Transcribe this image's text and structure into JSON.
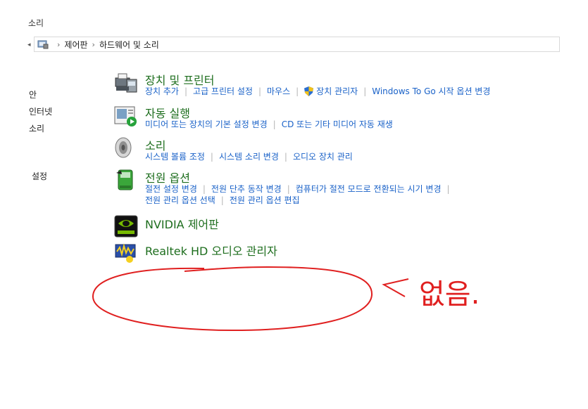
{
  "window": {
    "title": "소리"
  },
  "address": {
    "crumbs": [
      "제어판",
      "하드웨어 및 소리"
    ]
  },
  "left_nav": [
    "안",
    "인터넷",
    "소리",
    "설정"
  ],
  "categories": [
    {
      "title": "장치 및 프린터",
      "icon": "printer-icon",
      "rows": [
        [
          "장치 추가",
          "고급 프린터 설정",
          "마우스",
          "장치 관리자",
          "Windows To Go 시작 옵션 변경"
        ]
      ]
    },
    {
      "title": "자동 실행",
      "icon": "autoplay-icon",
      "rows": [
        [
          "미디어 또는 장치의 기본 설정 변경",
          "CD 또는 기타 미디어 자동 재생"
        ]
      ]
    },
    {
      "title": "소리",
      "icon": "speaker-icon",
      "rows": [
        [
          "시스템 볼륨 조정",
          "시스템 소리 변경",
          "오디오 장치 관리"
        ]
      ]
    },
    {
      "title": "전원 옵션",
      "icon": "battery-icon",
      "rows": [
        [
          "절전 설정 변경",
          "전원 단추 동작 변경",
          "컴퓨터가 절전 모드로 전환되는 시기 변경"
        ],
        [
          "전원 관리 옵션 선택",
          "전원 관리 옵션 편집"
        ]
      ]
    },
    {
      "title": "NVIDIA 제어판",
      "icon": "nvidia-icon",
      "rows": []
    },
    {
      "title": "Realtek HD 오디오 관리자",
      "icon": "realtek-icon",
      "rows": []
    }
  ],
  "annotation": {
    "text": "없음.",
    "color": "#e02020"
  }
}
